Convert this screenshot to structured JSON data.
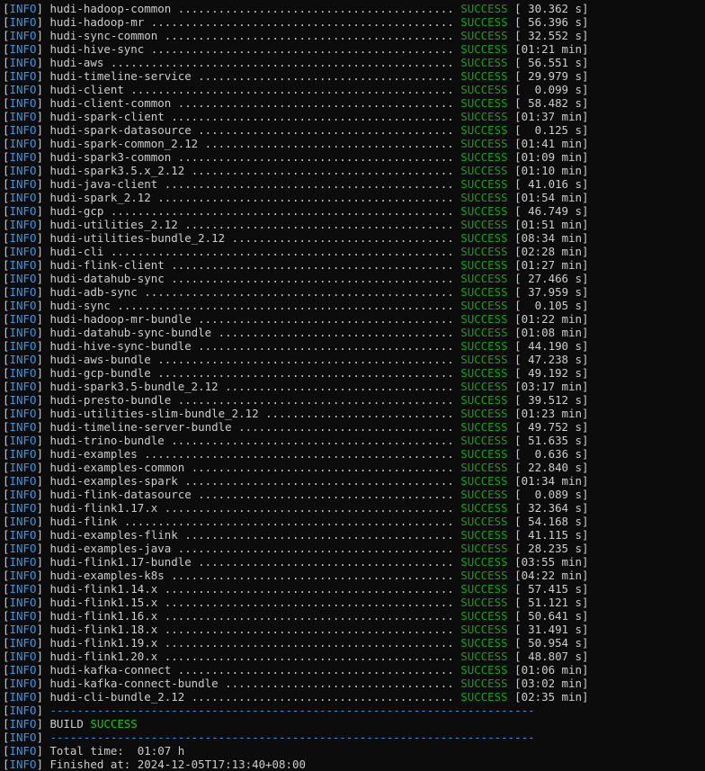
{
  "log_level": "INFO",
  "modules": [
    {
      "name": "hudi-hadoop-common",
      "dots": " ......................................... ",
      "status": "SUCCESS",
      "time": "[ 30.362 s]"
    },
    {
      "name": "hudi-hadoop-mr",
      "dots": " ............................................. ",
      "status": "SUCCESS",
      "time": "[ 56.396 s]"
    },
    {
      "name": "hudi-sync-common",
      "dots": " ........................................... ",
      "status": "SUCCESS",
      "time": "[ 32.552 s]"
    },
    {
      "name": "hudi-hive-sync",
      "dots": " ............................................. ",
      "status": "SUCCESS",
      "time": "[01:21 min]"
    },
    {
      "name": "hudi-aws",
      "dots": " ................................................... ",
      "status": "SUCCESS",
      "time": "[ 56.551 s]"
    },
    {
      "name": "hudi-timeline-service",
      "dots": " ...................................... ",
      "status": "SUCCESS",
      "time": "[ 29.979 s]"
    },
    {
      "name": "hudi-client",
      "dots": " ................................................ ",
      "status": "SUCCESS",
      "time": "[  0.099 s]"
    },
    {
      "name": "hudi-client-common",
      "dots": " ......................................... ",
      "status": "SUCCESS",
      "time": "[ 58.482 s]"
    },
    {
      "name": "hudi-spark-client",
      "dots": " .......................................... ",
      "status": "SUCCESS",
      "time": "[01:37 min]"
    },
    {
      "name": "hudi-spark-datasource",
      "dots": " ...................................... ",
      "status": "SUCCESS",
      "time": "[  0.125 s]"
    },
    {
      "name": "hudi-spark-common_2.12",
      "dots": " ..................................... ",
      "status": "SUCCESS",
      "time": "[01:41 min]"
    },
    {
      "name": "hudi-spark3-common",
      "dots": " ......................................... ",
      "status": "SUCCESS",
      "time": "[01:09 min]"
    },
    {
      "name": "hudi-spark3.5.x_2.12",
      "dots": " ....................................... ",
      "status": "SUCCESS",
      "time": "[01:10 min]"
    },
    {
      "name": "hudi-java-client",
      "dots": " ........................................... ",
      "status": "SUCCESS",
      "time": "[ 41.016 s]"
    },
    {
      "name": "hudi-spark_2.12",
      "dots": " ............................................ ",
      "status": "SUCCESS",
      "time": "[01:54 min]"
    },
    {
      "name": "hudi-gcp",
      "dots": " ................................................... ",
      "status": "SUCCESS",
      "time": "[ 46.749 s]"
    },
    {
      "name": "hudi-utilities_2.12",
      "dots": " ........................................ ",
      "status": "SUCCESS",
      "time": "[01:51 min]"
    },
    {
      "name": "hudi-utilities-bundle_2.12",
      "dots": " ................................. ",
      "status": "SUCCESS",
      "time": "[08:34 min]"
    },
    {
      "name": "hudi-cli",
      "dots": " ................................................... ",
      "status": "SUCCESS",
      "time": "[02:28 min]"
    },
    {
      "name": "hudi-flink-client",
      "dots": " .......................................... ",
      "status": "SUCCESS",
      "time": "[01:27 min]"
    },
    {
      "name": "hudi-datahub-sync",
      "dots": " .......................................... ",
      "status": "SUCCESS",
      "time": "[ 27.466 s]"
    },
    {
      "name": "hudi-adb-sync",
      "dots": " .............................................. ",
      "status": "SUCCESS",
      "time": "[ 37.959 s]"
    },
    {
      "name": "hudi-sync",
      "dots": " .................................................. ",
      "status": "SUCCESS",
      "time": "[  0.105 s]"
    },
    {
      "name": "hudi-hadoop-mr-bundle",
      "dots": " ...................................... ",
      "status": "SUCCESS",
      "time": "[01:22 min]"
    },
    {
      "name": "hudi-datahub-sync-bundle",
      "dots": " ................................... ",
      "status": "SUCCESS",
      "time": "[01:08 min]"
    },
    {
      "name": "hudi-hive-sync-bundle",
      "dots": " ...................................... ",
      "status": "SUCCESS",
      "time": "[ 44.190 s]"
    },
    {
      "name": "hudi-aws-bundle",
      "dots": " ............................................ ",
      "status": "SUCCESS",
      "time": "[ 47.238 s]"
    },
    {
      "name": "hudi-gcp-bundle",
      "dots": " ............................................ ",
      "status": "SUCCESS",
      "time": "[ 49.192 s]"
    },
    {
      "name": "hudi-spark3.5-bundle_2.12",
      "dots": " .................................. ",
      "status": "SUCCESS",
      "time": "[03:17 min]"
    },
    {
      "name": "hudi-presto-bundle",
      "dots": " ......................................... ",
      "status": "SUCCESS",
      "time": "[ 39.512 s]"
    },
    {
      "name": "hudi-utilities-slim-bundle_2.12",
      "dots": " ............................ ",
      "status": "SUCCESS",
      "time": "[01:23 min]"
    },
    {
      "name": "hudi-timeline-server-bundle",
      "dots": " ................................ ",
      "status": "SUCCESS",
      "time": "[ 49.752 s]"
    },
    {
      "name": "hudi-trino-bundle",
      "dots": " .......................................... ",
      "status": "SUCCESS",
      "time": "[ 51.635 s]"
    },
    {
      "name": "hudi-examples",
      "dots": " .............................................. ",
      "status": "SUCCESS",
      "time": "[  0.636 s]"
    },
    {
      "name": "hudi-examples-common",
      "dots": " ....................................... ",
      "status": "SUCCESS",
      "time": "[ 22.840 s]"
    },
    {
      "name": "hudi-examples-spark",
      "dots": " ........................................ ",
      "status": "SUCCESS",
      "time": "[01:34 min]"
    },
    {
      "name": "hudi-flink-datasource",
      "dots": " ...................................... ",
      "status": "SUCCESS",
      "time": "[  0.089 s]"
    },
    {
      "name": "hudi-flink1.17.x",
      "dots": " ........................................... ",
      "status": "SUCCESS",
      "time": "[ 32.364 s]"
    },
    {
      "name": "hudi-flink",
      "dots": " ................................................. ",
      "status": "SUCCESS",
      "time": "[ 54.168 s]"
    },
    {
      "name": "hudi-examples-flink",
      "dots": " ........................................ ",
      "status": "SUCCESS",
      "time": "[ 41.115 s]"
    },
    {
      "name": "hudi-examples-java",
      "dots": " ......................................... ",
      "status": "SUCCESS",
      "time": "[ 28.235 s]"
    },
    {
      "name": "hudi-flink1.17-bundle",
      "dots": " ...................................... ",
      "status": "SUCCESS",
      "time": "[03:55 min]"
    },
    {
      "name": "hudi-examples-k8s",
      "dots": " .......................................... ",
      "status": "SUCCESS",
      "time": "[04:22 min]"
    },
    {
      "name": "hudi-flink1.14.x",
      "dots": " ........................................... ",
      "status": "SUCCESS",
      "time": "[ 57.415 s]"
    },
    {
      "name": "hudi-flink1.15.x",
      "dots": " ........................................... ",
      "status": "SUCCESS",
      "time": "[ 51.121 s]"
    },
    {
      "name": "hudi-flink1.16.x",
      "dots": " ........................................... ",
      "status": "SUCCESS",
      "time": "[ 50.641 s]"
    },
    {
      "name": "hudi-flink1.18.x",
      "dots": " ........................................... ",
      "status": "SUCCESS",
      "time": "[ 31.491 s]"
    },
    {
      "name": "hudi-flink1.19.x",
      "dots": " ........................................... ",
      "status": "SUCCESS",
      "time": "[ 50.954 s]"
    },
    {
      "name": "hudi-flink1.20.x",
      "dots": " ........................................... ",
      "status": "SUCCESS",
      "time": "[ 48.807 s]"
    },
    {
      "name": "hudi-kafka-connect",
      "dots": " ......................................... ",
      "status": "SUCCESS",
      "time": "[01:06 min]"
    },
    {
      "name": "hudi-kafka-connect-bundle",
      "dots": " .................................. ",
      "status": "SUCCESS",
      "time": "[03:02 min]"
    },
    {
      "name": "hudi-cli-bundle_2.12",
      "dots": " ....................................... ",
      "status": "SUCCESS",
      "time": "[02:35 min]"
    }
  ],
  "separator": "------------------------------------------------------------------------",
  "build_label": "BUILD ",
  "build_status": "SUCCESS",
  "total_time_line": "Total time:  01:07 h",
  "clipped_line": "Finished at: 2024-12-05T17:13:40+08:00",
  "colors": {
    "background": "#0c0c0c",
    "text": "#cccccc",
    "info": "#3a96dd",
    "success": "#13a10e",
    "build_success": "#16c60c"
  }
}
